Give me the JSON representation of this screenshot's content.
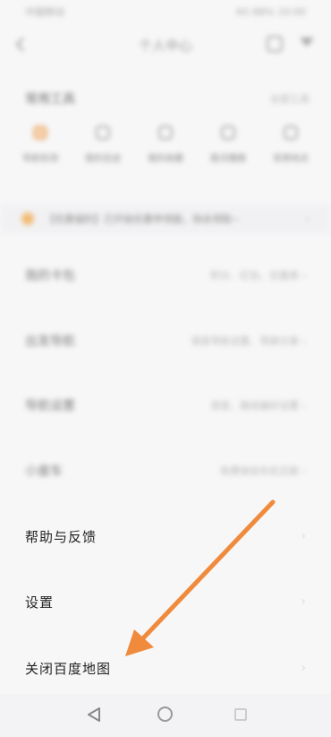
{
  "status_bar": {
    "left": "中国移动",
    "right": "4G 88% 10:00"
  },
  "header": {
    "title": "个人中心"
  },
  "section": {
    "title": "常用工具",
    "more": "全部工具"
  },
  "tools": [
    {
      "label": "导航检测"
    },
    {
      "label": "我的足迹"
    },
    {
      "label": "我的收藏"
    },
    {
      "label": "路况播报"
    },
    {
      "label": "常用地点"
    }
  ],
  "notice": {
    "text": "【优惠福利】已开始优惠申领版，快去领取~",
    "arrow": "›"
  },
  "blurred_menu": [
    {
      "label": "我的卡包",
      "sub": "积分、红包、优惠券 ›"
    },
    {
      "label": "出发导航",
      "sub": "语音导航设置、驾驶记录 ›"
    },
    {
      "label": "导航设置",
      "sub": "语音、路线偏好设置 ›"
    },
    {
      "label": "小度车",
      "sub": "免费体验车机互联 ›"
    }
  ],
  "menu": [
    {
      "label": "帮助与反馈",
      "chevron": "›"
    },
    {
      "label": "设置",
      "chevron": "›"
    },
    {
      "label": "关闭百度地图",
      "chevron": "›"
    }
  ],
  "colors": {
    "arrow": "#f08a3c",
    "background": "#f7f7f8"
  },
  "nav_icons": {
    "back": "back-triangle-icon",
    "home": "home-circle-icon",
    "recent": "recent-apps-icon"
  }
}
